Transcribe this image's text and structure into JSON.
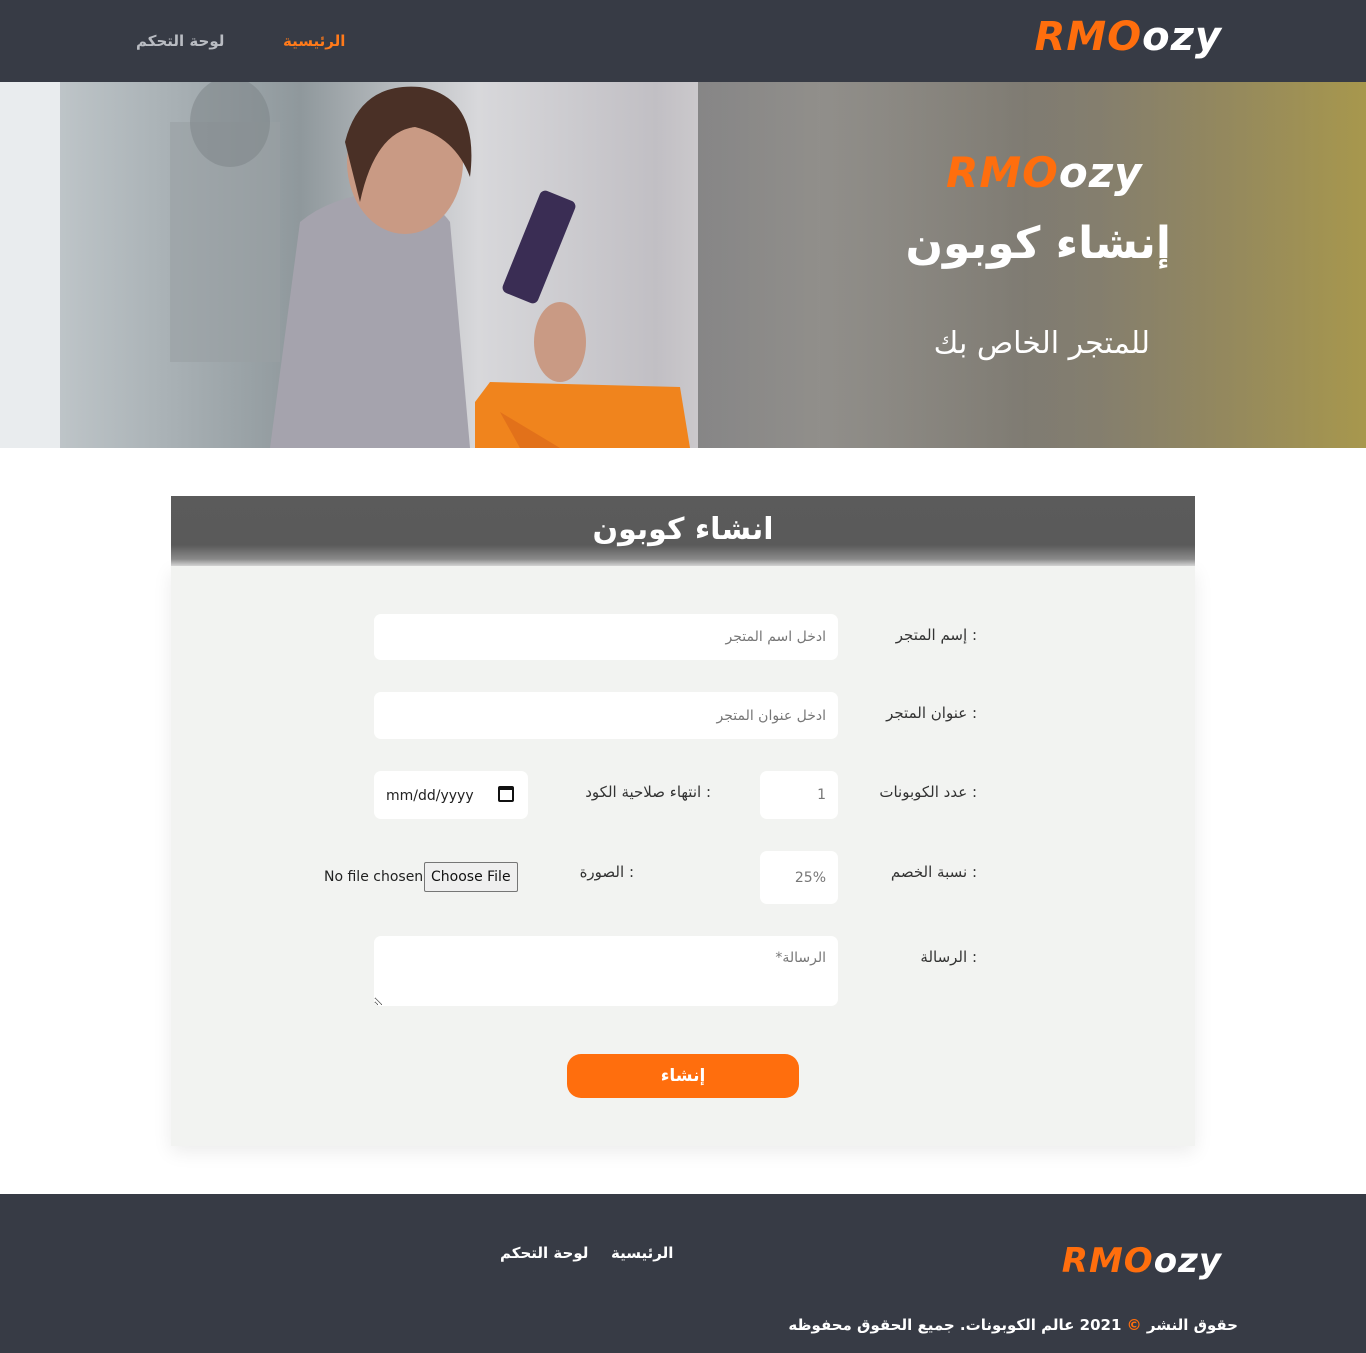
{
  "brand": {
    "part1": "RMO",
    "part2": "ozy"
  },
  "nav": {
    "home": "الرئيسية",
    "dashboard": "لوحة التحكم"
  },
  "hero": {
    "title": "إنشاء كوبون",
    "subtitle": "للمتجر الخاص بك"
  },
  "form": {
    "title": "انشاء كوبون",
    "store_name": {
      "label": "إسم المتجر :",
      "placeholder": "ادخل اسم المتجر"
    },
    "store_address": {
      "label": "عنوان المتجر :",
      "placeholder": "ادخل عنوان المتجر"
    },
    "coupon_count": {
      "label": "عدد الكوبونات :",
      "placeholder": "1"
    },
    "expiry": {
      "label": "انتهاء صلاحية الكود :",
      "value": "mm/dd/yyyy"
    },
    "discount": {
      "label": "نسبة الخصم :",
      "placeholder": "25%"
    },
    "image": {
      "label": "الصورة :",
      "button": "Choose File",
      "status": "No file chosen"
    },
    "message": {
      "label": "الرسالة :",
      "placeholder": "الرسالة*"
    },
    "submit": "إنشاء"
  },
  "footer": {
    "home": "الرئيسية",
    "dashboard": "لوحة التحكم",
    "copyright_prefix": "حقوق النشر",
    "copyright_symbol": "©",
    "copyright_text": "2021 عالم الكوبونات. جميع الحقوق محفوظه"
  },
  "colors": {
    "accent": "#ff6e0d",
    "dark": "#373b45",
    "card": "#f2f3f1"
  }
}
